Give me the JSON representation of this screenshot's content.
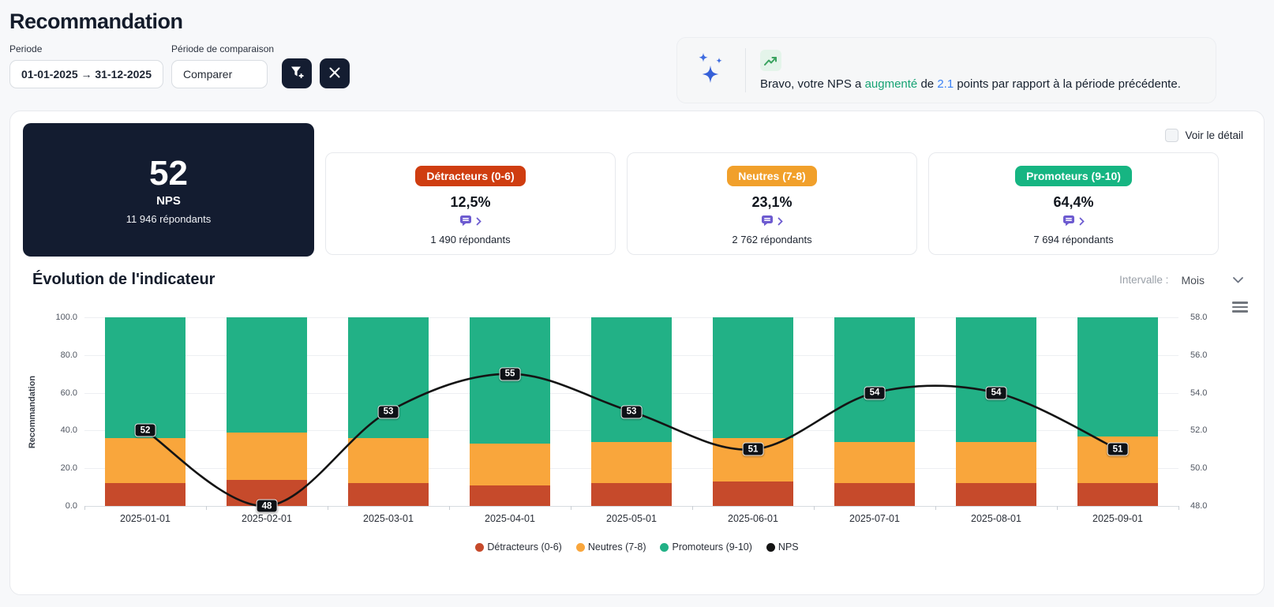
{
  "page": {
    "title": "Recommandation"
  },
  "filters": {
    "periode_label": "Periode",
    "periode_value": "01-01-2025 → 31-12-2025",
    "comparison_label": "Période de comparaison",
    "comparison_value": "Comparer"
  },
  "insight": {
    "prefix": "Bravo, votre NPS a ",
    "trend_word": "augmenté",
    "mid": " de ",
    "delta": "2.1",
    "suffix": " points par rapport à la période précédente."
  },
  "detail_toggle_label": "Voir le détail",
  "kpis": {
    "nps": {
      "value": "52",
      "label": "NPS",
      "respondents": "11 946 répondants"
    },
    "cards": [
      {
        "badge": "Détracteurs (0-6)",
        "value": "12,5%",
        "respondents": "1 490 répondants",
        "badge_color": "#cf3d10"
      },
      {
        "badge": "Neutres (7-8)",
        "value": "23,1%",
        "respondents": "2 762 répondants",
        "badge_color": "#f1a02b"
      },
      {
        "badge": "Promoteurs (9-10)",
        "value": "64,4%",
        "respondents": "7 694 répondants",
        "badge_color": "#16b582"
      }
    ]
  },
  "section": {
    "title": "Évolution de l'indicateur",
    "interval_label": "Intervalle :",
    "interval_value": "Mois"
  },
  "chart_data": {
    "type": "bar",
    "subtype": "percent-stacked columns with NPS line overlay",
    "categories": [
      "2025-01-01",
      "2025-02-01",
      "2025-03-01",
      "2025-04-01",
      "2025-05-01",
      "2025-06-01",
      "2025-07-01",
      "2025-08-01",
      "2025-09-01"
    ],
    "series": [
      {
        "name": "Détracteurs (0-6)",
        "type": "bar",
        "color": "#c64a2b",
        "axis": "left",
        "values": [
          12,
          14,
          12,
          11,
          12,
          13,
          12,
          12,
          12
        ]
      },
      {
        "name": "Neutres (7-8)",
        "type": "bar",
        "color": "#f9a63c",
        "axis": "left",
        "values": [
          24,
          25,
          24,
          22,
          22,
          23,
          22,
          22,
          25
        ]
      },
      {
        "name": "Promoteurs (9-10)",
        "type": "bar",
        "color": "#22b186",
        "axis": "left",
        "values": [
          64,
          61,
          64,
          67,
          66,
          64,
          66,
          66,
          63
        ]
      },
      {
        "name": "NPS",
        "type": "line",
        "color": "#141414",
        "axis": "right",
        "values": [
          52,
          48,
          53,
          55,
          53,
          51,
          54,
          54,
          51
        ]
      }
    ],
    "left_axis": {
      "title": "Recommandation",
      "min": 0,
      "max": 100,
      "ticks": [
        "0.0",
        "20.0",
        "40.0",
        "60.0",
        "80.0",
        "100.0"
      ]
    },
    "right_axis": {
      "min": 48,
      "max": 58,
      "ticks": [
        "48.0",
        "50.0",
        "52.0",
        "54.0",
        "56.0",
        "58.0"
      ]
    },
    "grid": true,
    "legend_position": "bottom",
    "bar_width_ratio": 0.66
  }
}
